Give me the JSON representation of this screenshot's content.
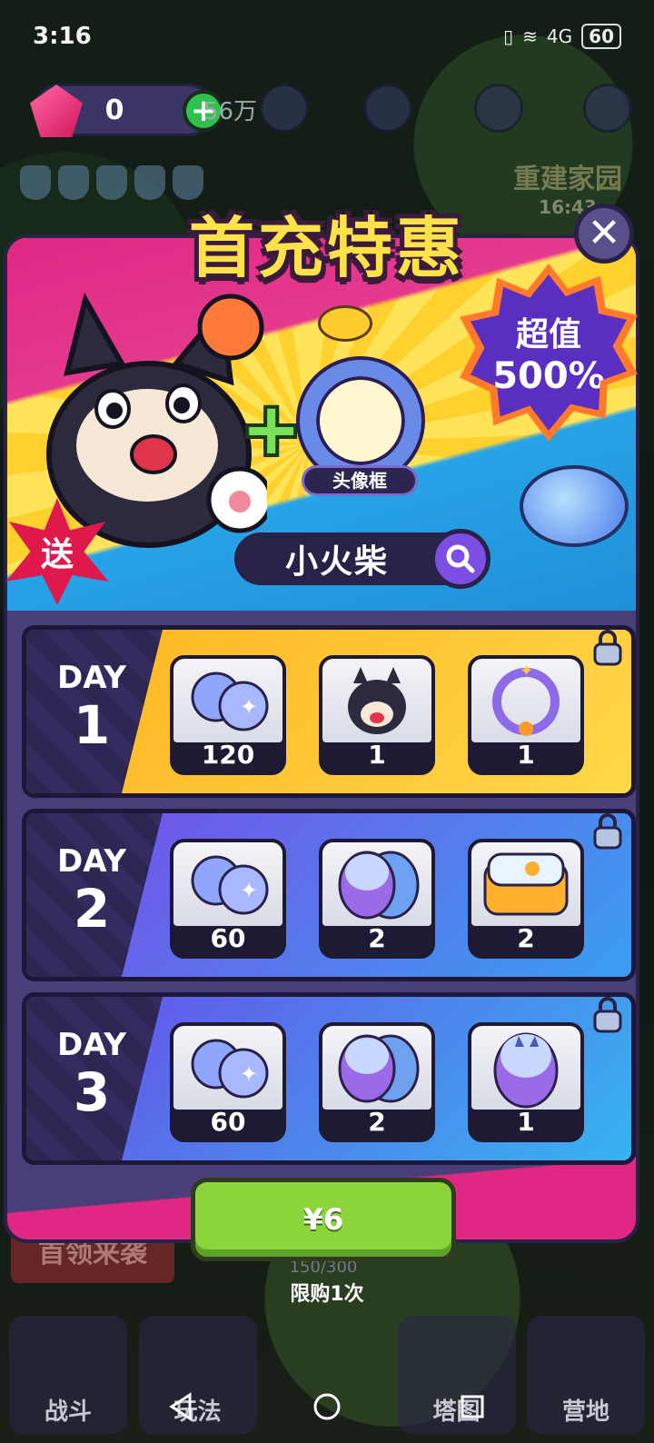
{
  "status_bar": {
    "time": "3:16",
    "network": "4G",
    "battery": "60"
  },
  "hud": {
    "gems": "0",
    "coins_partial": "56万",
    "rebuild_title": "重建家园",
    "rebuild_time": "16:43"
  },
  "dialog": {
    "title": "首充特惠",
    "value_badge_line1": "超值",
    "value_badge_line2": "500%",
    "gift_label": "送",
    "frame_label": "头像框",
    "pet_name": "小火柴",
    "days": [
      {
        "day_word": "DAY",
        "day_num": "1",
        "items": [
          {
            "icon": "crystal-orbs-icon",
            "count": "120"
          },
          {
            "icon": "shiba-pet-icon",
            "count": "1"
          },
          {
            "icon": "avatar-frame-icon",
            "count": "1"
          }
        ]
      },
      {
        "day_word": "DAY",
        "day_num": "2",
        "items": [
          {
            "icon": "crystal-orbs-icon",
            "count": "60"
          },
          {
            "icon": "capsule-eggs-icon",
            "count": "2"
          },
          {
            "icon": "lunchbox-icon",
            "count": "2"
          }
        ]
      },
      {
        "day_word": "DAY",
        "day_num": "3",
        "items": [
          {
            "icon": "crystal-orbs-icon",
            "count": "60"
          },
          {
            "icon": "capsule-eggs-icon",
            "count": "2"
          },
          {
            "icon": "capsule-egg-icon",
            "count": "1"
          }
        ]
      }
    ],
    "buy_price": "¥6",
    "limit_text": "限购1次"
  },
  "background": {
    "boss_banner": "首领来袭",
    "progress": "150/300",
    "tabs": [
      "战斗",
      "玩法",
      "",
      "塔图",
      "营地"
    ]
  },
  "colors": {
    "dialog_bg": "#4a3e7a",
    "title_yellow": "#ffe24a",
    "buy_green": "#8bd43a",
    "day1_bg": "#ffc12e",
    "day2_bg": "#7a4be8",
    "day3_bg": "#6a5ae8"
  }
}
